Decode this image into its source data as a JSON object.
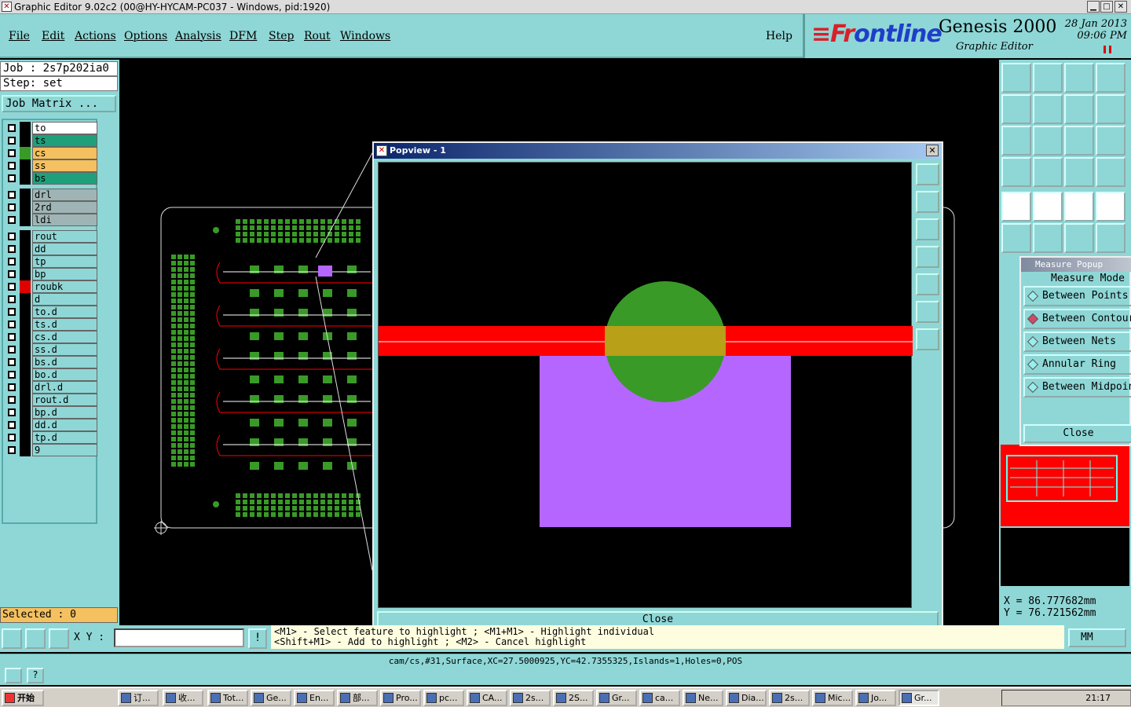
{
  "window": {
    "title": "Graphic Editor 9.02c2 (00@HY-HYCAM-PC037 - Windows, pid:1920)"
  },
  "menu": [
    "File",
    "Edit",
    "Actions",
    "Options",
    "Analysis",
    "DFM",
    "Step",
    "Rout",
    "Windows"
  ],
  "help": "Help",
  "brand": {
    "logo_a": "≡Fr",
    "logo_b": "o",
    "logo_c": "ntline",
    "product": "Genesis 2000",
    "subtitle": "Graphic Editor",
    "date": "28 Jan 2013",
    "time": "09:06 PM"
  },
  "job": {
    "job_line": "Job : 2s7p202ia0",
    "step_line": "Step: set",
    "job_matrix": "Job Matrix ..."
  },
  "layers": [
    {
      "name": "to",
      "color": "#ffffff",
      "sw": "#000000"
    },
    {
      "name": "ts",
      "color": "#1fa07a",
      "sw": "#000000"
    },
    {
      "name": "cs",
      "color": "#f4c060",
      "sw": "#3a9a28"
    },
    {
      "name": "ss",
      "color": "#f4c060",
      "sw": "#000000"
    },
    {
      "name": "bs",
      "color": "#1fa07a",
      "sw": "#000000"
    },
    {
      "name": "drl",
      "color": "#9fb4b4",
      "sw": "#000000"
    },
    {
      "name": "2rd",
      "color": "#9fb4b4",
      "sw": "#000000"
    },
    {
      "name": "ldi",
      "color": "#9fb4b4",
      "sw": "#000000"
    },
    {
      "name": "rout",
      "color": "#8fd6d6",
      "sw": "#000000"
    },
    {
      "name": "dd",
      "color": "#8fd6d6",
      "sw": "#000000"
    },
    {
      "name": "tp",
      "color": "#8fd6d6",
      "sw": "#000000"
    },
    {
      "name": "bp",
      "color": "#8fd6d6",
      "sw": "#000000"
    },
    {
      "name": "roubk",
      "color": "#8fd6d6",
      "sw": "#e00000"
    },
    {
      "name": "d",
      "color": "#8fd6d6",
      "sw": "#000000"
    },
    {
      "name": "to.d",
      "color": "#8fd6d6",
      "sw": "#000000"
    },
    {
      "name": "ts.d",
      "color": "#8fd6d6",
      "sw": "#000000"
    },
    {
      "name": "cs.d",
      "color": "#8fd6d6",
      "sw": "#000000"
    },
    {
      "name": "ss.d",
      "color": "#8fd6d6",
      "sw": "#000000"
    },
    {
      "name": "bs.d",
      "color": "#8fd6d6",
      "sw": "#000000"
    },
    {
      "name": "bo.d",
      "color": "#8fd6d6",
      "sw": "#000000"
    },
    {
      "name": "drl.d",
      "color": "#8fd6d6",
      "sw": "#000000"
    },
    {
      "name": "rout.d",
      "color": "#8fd6d6",
      "sw": "#000000"
    },
    {
      "name": "bp.d",
      "color": "#8fd6d6",
      "sw": "#000000"
    },
    {
      "name": "dd.d",
      "color": "#8fd6d6",
      "sw": "#000000"
    },
    {
      "name": "tp.d",
      "color": "#8fd6d6",
      "sw": "#000000"
    },
    {
      "name": "9",
      "color": "#8fd6d6",
      "sw": "#000000"
    }
  ],
  "selected": "Selected : 0",
  "popview": {
    "title": "Popview - 1",
    "close": "Close"
  },
  "measure": {
    "title": "Measure Popup",
    "mode_label": "Measure Mode",
    "options": [
      "Between Points",
      "Between Contours",
      "Between Nets",
      "Annular Ring",
      "Between Midpoints"
    ],
    "active_index": 1,
    "close": "Close"
  },
  "coords": {
    "x": "X  =  86.777682mm",
    "y": "Y  =  76.721562mm"
  },
  "bottom": {
    "xy_label": "X Y :",
    "xy_value": "",
    "hint1": "<M1> - Select feature to highlight ; <M1+M1> - Highlight individual",
    "hint2": "<Shift+M1> - Add to highlight ; <M2> - Cancel highlight",
    "units": "MM"
  },
  "status": "cam/cs,#31,Surface,XC=27.5000925,YC=42.7355325,Islands=1,Holes=0,POS",
  "taskbar": {
    "start": "开始",
    "tasks": [
      "订...",
      "收...",
      "Tot...",
      "Ge...",
      "En...",
      "部...",
      "Pro...",
      "pc...",
      "CA...",
      "2s...",
      "2S...",
      "Gr...",
      "ca...",
      "Ne...",
      "Dia...",
      "2s...",
      "Mic...",
      "Jo...",
      "Gr..."
    ],
    "clock": "21:17"
  },
  "colors": {
    "accent": "#8fd6d6",
    "pad_green": "#3a9a28",
    "trace_red": "#ff0000",
    "surface_purple": "#b466ff"
  }
}
